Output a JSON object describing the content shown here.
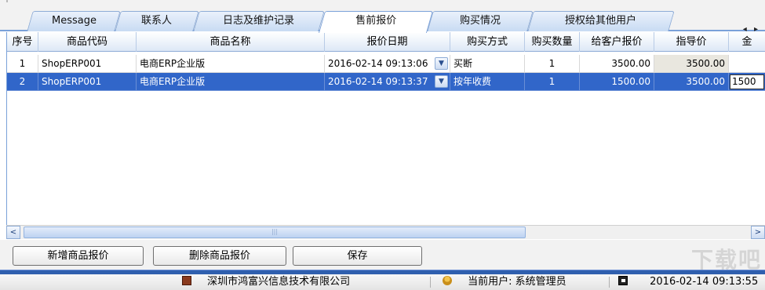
{
  "tabs": [
    {
      "label": "Message"
    },
    {
      "label": "联系人"
    },
    {
      "label": "日志及维护记录"
    },
    {
      "label": "售前报价"
    },
    {
      "label": "购买情况"
    },
    {
      "label": "授权给其他用户"
    }
  ],
  "active_tab": "售前报价",
  "table": {
    "columns": [
      "序号",
      "商品代码",
      "商品名称",
      "报价日期",
      "购买方式",
      "购买数量",
      "给客户报价",
      "指导价",
      "金"
    ],
    "rows": [
      {
        "no": "1",
        "code": "ShopERP001",
        "name": "电商ERP企业版",
        "date": "2016-02-14 09:13:06",
        "method": "买断",
        "qty": "1",
        "quote": "3500.00",
        "guide": "3500.00",
        "amount": ""
      },
      {
        "no": "2",
        "code": "ShopERP001",
        "name": "电商ERP企业版",
        "date": "2016-02-14 09:13:37",
        "method": "按年收费",
        "qty": "1",
        "quote": "1500.00",
        "guide": "3500.00",
        "amount": "1500"
      }
    ],
    "selected_row": 2
  },
  "scrollbar": {
    "left_arrow": "<",
    "right_arrow": ">",
    "grip": "|||"
  },
  "buttons": {
    "add": "新增商品报价",
    "delete": "删除商品报价",
    "save": "保存"
  },
  "watermark": "下载吧",
  "statusbar": {
    "company": "深圳市鸿富兴信息技术有限公司",
    "current_user_label": "当前用户:",
    "current_user": "系统管理员",
    "datetime": "2016-02-14 09:13:55"
  },
  "colors": {
    "selection": "#3166c9",
    "tab_border": "#7aa1d9",
    "status_strip": "#2f5fae"
  }
}
